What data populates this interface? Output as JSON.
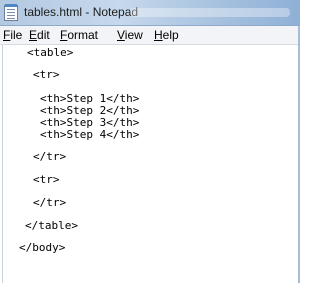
{
  "window": {
    "title": "tables.html - Notepad",
    "icon": "notepad-icon"
  },
  "menu": {
    "items": [
      {
        "label": "File",
        "accel": "F",
        "rest": "ile"
      },
      {
        "label": "Edit",
        "accel": "E",
        "rest": "dit"
      },
      {
        "label": "Format",
        "accel": "F",
        "rest": "ormat"
      },
      {
        "label": "View",
        "accel": "V",
        "rest": "iew"
      },
      {
        "label": "Help",
        "accel": "H",
        "rest": "elp"
      }
    ]
  },
  "editor": {
    "lines": [
      "<table>",
      "<tr>",
      "<th>Step 1</th>",
      "<th>Step 2</th>",
      "<th>Step 3</th>",
      "<th>Step 4</th>",
      "</tr>",
      "<tr>",
      "</tr>",
      "</table>",
      "</body>"
    ]
  }
}
